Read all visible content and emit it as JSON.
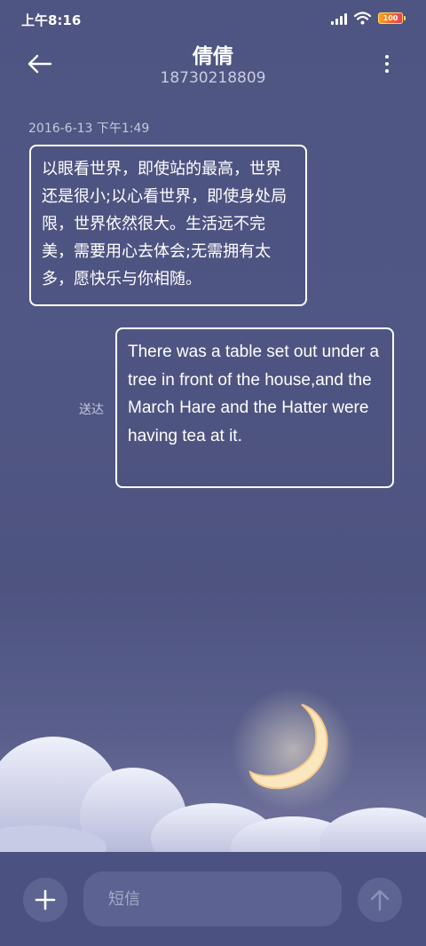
{
  "status_bar": {
    "time": "上午8:16",
    "battery": "100"
  },
  "header": {
    "contact_name": "倩倩",
    "contact_number": "18730218809"
  },
  "conversation": {
    "timestamp": "2016-6-13 下午1:49",
    "messages": [
      {
        "direction": "incoming",
        "text": "以眼看世界，即使站的最高，世界还是很小;以心看世界，即使身处局限，世界依然很大。生活远不完美，需要用心去体会;无需拥有太多，愿快乐与你相随。"
      },
      {
        "direction": "outgoing",
        "status": "送达",
        "text": "There was a table set out under a tree in front of the house,and the March Hare and the Hatter were having tea at it."
      }
    ]
  },
  "composer": {
    "placeholder": "短信"
  },
  "icons": {
    "back": "back-arrow-icon",
    "more": "more-vertical-icon",
    "add": "plus-icon",
    "send": "arrow-up-icon"
  },
  "colors": {
    "background": "#4f5582",
    "bubble_border": "#ffffff",
    "input_bg": "#5c6291"
  }
}
